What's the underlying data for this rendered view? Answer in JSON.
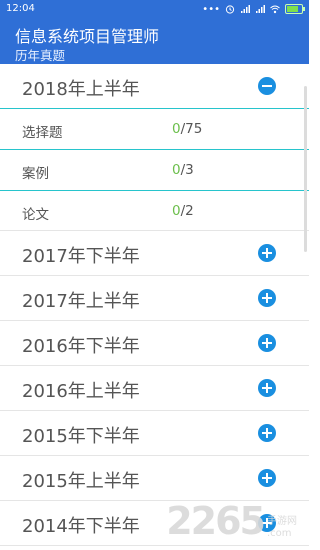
{
  "statusbar": {
    "time": "12:04"
  },
  "header": {
    "title": "信息系统项目管理师",
    "subtitle": "历年真题"
  },
  "expanded_group": {
    "label": "2018年上半年",
    "items": [
      {
        "label": "选择题",
        "done": "0",
        "total": "/75"
      },
      {
        "label": "案例",
        "done": "0",
        "total": "/3"
      },
      {
        "label": "论文",
        "done": "0",
        "total": "/2"
      }
    ]
  },
  "groups": [
    {
      "label": "2017年下半年"
    },
    {
      "label": "2017年上半年"
    },
    {
      "label": "2016年下半年"
    },
    {
      "label": "2016年上半年"
    },
    {
      "label": "2015年下半年"
    },
    {
      "label": "2015年上半年"
    },
    {
      "label": "2014年下半年"
    }
  ],
  "watermark": {
    "number": "2265",
    "suffix": "手游网",
    "domain": ".com"
  },
  "colors": {
    "primary": "#2f6fd6",
    "accent_button": "#1a8fe0",
    "progress_done": "#6cbf4c",
    "divider_active": "#27c4cc"
  }
}
